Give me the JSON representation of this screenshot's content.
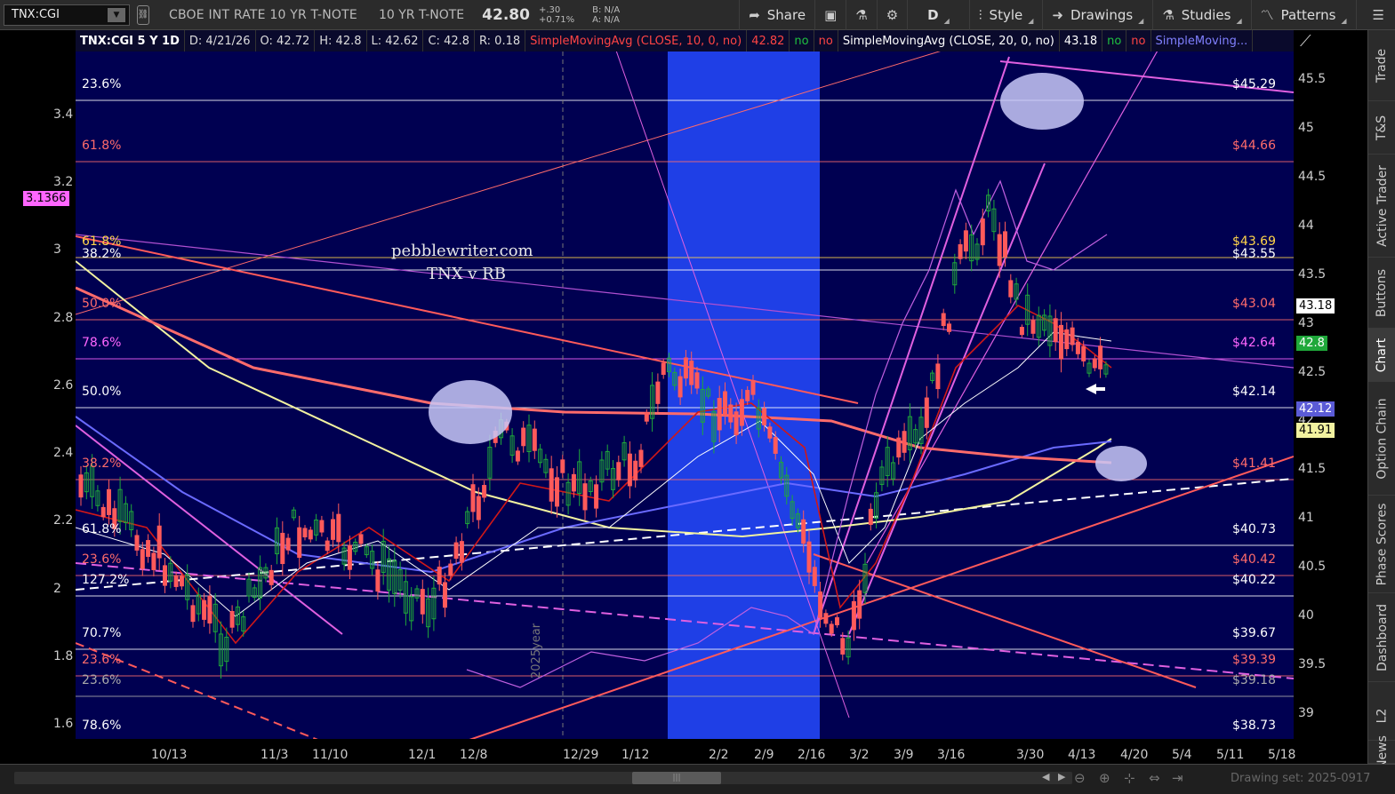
{
  "toolbar": {
    "symbol": "TNX:CGI",
    "description": "CBOE INT RATE 10 YR T-NOTE",
    "description2": "10 YR T-NOTE",
    "last": "42.80",
    "change": "+.30",
    "change_pct": "+0.71%",
    "bid": "B: N/A",
    "ask": "A: N/A",
    "share": "Share",
    "period": "D",
    "style": "Style",
    "drawings": "Drawings",
    "studies": "Studies",
    "patterns": "Patterns"
  },
  "title": {
    "symbol_period": "TNX:CGI 5 Y 1D",
    "date": "D: 4/21/26",
    "open": "O: 42.72",
    "high": "H: 42.8",
    "low": "L: 42.62",
    "close": "C: 42.8",
    "range": "R: 0.18",
    "sma10": "SimpleMovingAvg (CLOSE, 10, 0, no)",
    "sma10_val": "42.82",
    "sma20": "SimpleMovingAvg (CLOSE, 20, 0, no)",
    "sma20_val": "43.18",
    "flag_no": "no",
    "sma_more": "SimpleMoving..."
  },
  "watermark": {
    "line1": "pebblewriter.com",
    "line2": "TNX v RB"
  },
  "left_axis": {
    "ticks": [
      "3.4",
      "3.2",
      "3",
      "2.8",
      "2.6",
      "2.4",
      "2.2",
      "2",
      "1.8",
      "1.6"
    ],
    "marker": "3.1366"
  },
  "right_axis": {
    "ticks": [
      "45.5",
      "45",
      "44.5",
      "44",
      "43.5",
      "43",
      "42.5",
      "42",
      "41.5",
      "41",
      "40.5",
      "40",
      "39.5",
      "39"
    ],
    "badges": [
      {
        "label": "43.18",
        "bg": "#ffffff",
        "fg": "#000000"
      },
      {
        "label": "42.8",
        "bg": "#1fa83a",
        "fg": "#ffffff"
      },
      {
        "label": "42.12",
        "bg": "#5b5bd6",
        "fg": "#ffffff"
      },
      {
        "label": "41.91",
        "bg": "#f2f2a0",
        "fg": "#000000"
      }
    ]
  },
  "fib_levels": [
    {
      "left": "23.6%",
      "right": "$45.29",
      "color": "#ffffff"
    },
    {
      "left": "61.8%",
      "right": "$44.66",
      "color": "#ff6b6b"
    },
    {
      "left": "61.8%",
      "right": "$43.69",
      "color": "#ffd54a"
    },
    {
      "left": "38.2%",
      "right": "$43.55",
      "color": "#ffffff"
    },
    {
      "left": "50.0%",
      "right": "$43.04",
      "color": "#ff6b6b"
    },
    {
      "left": "78.6%",
      "right": "$42.64",
      "color": "#ff66ff"
    },
    {
      "left": "50.0%",
      "right": "$42.14",
      "color": "#ffffff"
    },
    {
      "left": "38.2%",
      "right": "$41.41",
      "color": "#ff6b6b"
    },
    {
      "left": "61.8%",
      "right": "$40.73",
      "color": "#ffffff"
    },
    {
      "left": "23.6%",
      "right": "$40.42",
      "color": "#ff6b6b"
    },
    {
      "left": "127.2%",
      "right": "$40.22",
      "color": "#ffffff"
    },
    {
      "left": "70.7%",
      "right": "$39.67",
      "color": "#ffffff"
    },
    {
      "left": "23.6%",
      "right": "$39.39",
      "color": "#ff6b6b"
    },
    {
      "left": "23.6%",
      "right": "$39.18",
      "color": "#aaaaaa"
    },
    {
      "left": "78.6%",
      "right": "$38.73",
      "color": "#ffffff"
    }
  ],
  "x_axis": [
    "10/13",
    "11/3",
    "11/10",
    "12/1",
    "12/8",
    "12/29",
    "1/12",
    "2/2",
    "2/9",
    "2/16",
    "3/2",
    "3/9",
    "3/16",
    "3/30",
    "4/13",
    "4/20",
    "5/4",
    "5/11",
    "5/18"
  ],
  "year_marker": "2025year",
  "sidebar": [
    "Trade",
    "T&S",
    "Active Trader",
    "Buttons",
    "Chart",
    "Option Chain",
    "Phase Scores",
    "Dashboard",
    "L2",
    "News"
  ],
  "drawing_set": "Drawing set: 2025-0917",
  "colors": {
    "plot_bg": "#000051",
    "highlight": "#1f3fe6",
    "up": "#1fa83a",
    "down": "#ff5a5a"
  }
}
